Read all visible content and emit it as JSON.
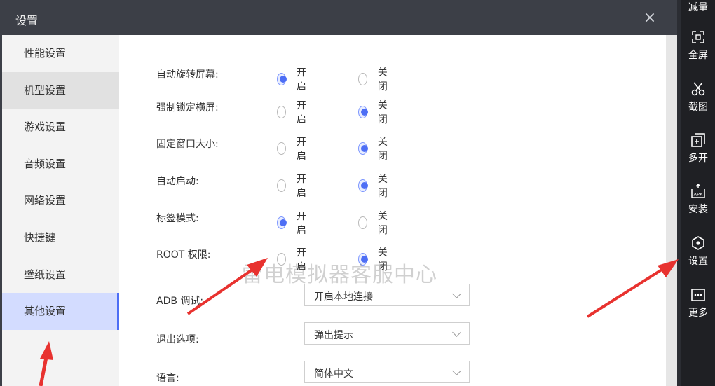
{
  "dialog": {
    "title": "设置",
    "close_icon": "×"
  },
  "sidebar": {
    "items": [
      {
        "label": "性能设置"
      },
      {
        "label": "机型设置"
      },
      {
        "label": "游戏设置"
      },
      {
        "label": "音频设置"
      },
      {
        "label": "网络设置"
      },
      {
        "label": "快捷键"
      },
      {
        "label": "壁纸设置"
      },
      {
        "label": "其他设置"
      }
    ],
    "active_index": 7,
    "hover_index": 1
  },
  "settings": {
    "on_label": "开启",
    "off_label": "关闭",
    "rows": [
      {
        "label": "自动旋转屏幕:",
        "value": "on"
      },
      {
        "label": "强制锁定横屏:",
        "value": "off"
      },
      {
        "label": "固定窗口大小:",
        "value": "off"
      },
      {
        "label": "自动启动:",
        "value": "off"
      },
      {
        "label": "标签模式:",
        "value": "on"
      },
      {
        "label": "ROOT 权限:",
        "value": "off"
      }
    ],
    "selects": [
      {
        "label": "ADB 调试:",
        "value": "开启本地连接"
      },
      {
        "label": "退出选项:",
        "value": "弹出提示"
      },
      {
        "label": "语言:",
        "value": "简体中文"
      }
    ]
  },
  "watermark": "雷电模拟器客服中心",
  "toolbar": {
    "items": [
      {
        "label": "减量",
        "icon": "volume-down-icon"
      },
      {
        "label": "全屏",
        "icon": "fullscreen-icon"
      },
      {
        "label": "截图",
        "icon": "scissors-icon"
      },
      {
        "label": "多开",
        "icon": "multi-instance-icon"
      },
      {
        "label": "安装",
        "icon": "apk-install-icon"
      },
      {
        "label": "设置",
        "icon": "settings-icon"
      },
      {
        "label": "更多",
        "icon": "more-icon"
      }
    ]
  },
  "colors": {
    "accent": "#4d6ef5",
    "arrow": "#e8322f",
    "titlebar": "#3c3f47",
    "toolbar": "#1f2024"
  }
}
